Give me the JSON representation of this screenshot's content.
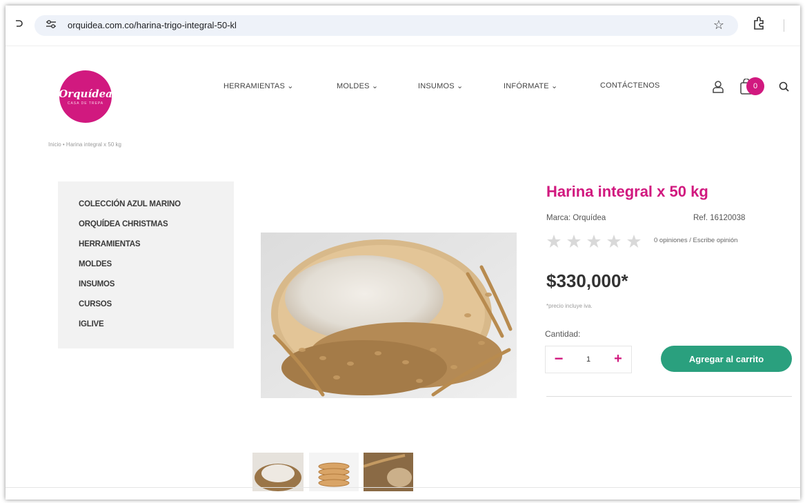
{
  "browser": {
    "url": "orquidea.com.co/harina-trigo-integral-50-kl"
  },
  "logo": {
    "text": "Orquídea",
    "subtitle": "CASA DE TREPA",
    "color": "#d1197f"
  },
  "nav": {
    "items": [
      {
        "label": "HERRAMIENTAS ⌄"
      },
      {
        "label": "MOLDES ⌄"
      },
      {
        "label": "INSUMOS ⌄"
      },
      {
        "label": "INFÓRMATE ⌄"
      },
      {
        "label": "CONTÁCTENOS"
      }
    ],
    "cart_count": "0"
  },
  "breadcrumb": {
    "text": "Inicio  •  Harina integral x 50 kg"
  },
  "sidebar": {
    "items": [
      {
        "label": "COLECCIÓN AZUL MARINO"
      },
      {
        "label": "ORQUÍDEA CHRISTMAS"
      },
      {
        "label": "HERRAMIENTAS"
      },
      {
        "label": "MOLDES"
      },
      {
        "label": "INSUMOS"
      },
      {
        "label": "CURSOS"
      },
      {
        "label": "IGLIVE"
      }
    ]
  },
  "product": {
    "title": "Harina integral x 50 kg",
    "brand": "Marca: Orquídea",
    "ref": "Ref. 16120038",
    "rating": 0,
    "reviews": "0 opiniones / Escribe opinión",
    "price": "$330,000*",
    "price_note": "*precio incluye iva.",
    "quantity_label": "Cantidad:",
    "quantity": "1",
    "add_to_cart": "Agregar al carrito"
  },
  "colors": {
    "accent": "#d1197f",
    "button": "#2aa07e"
  }
}
